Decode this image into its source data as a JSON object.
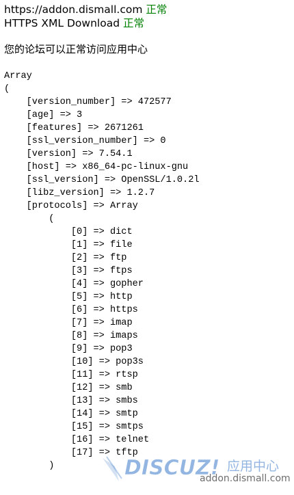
{
  "status": {
    "addon_host": "https://addon.dismall.com",
    "addon_state": "正常",
    "https_xml_label": "HTTPS XML Download",
    "https_xml_state": "正常",
    "message": "您的论坛可以正常访问应用中心"
  },
  "dump_text": "Array\n(\n    [version_number] => 472577\n    [age] => 3\n    [features] => 2671261\n    [ssl_version_number] => 0\n    [version] => 7.54.1\n    [host] => x86_64-pc-linux-gnu\n    [ssl_version] => OpenSSL/1.0.2l\n    [libz_version] => 1.2.7\n    [protocols] => Array\n        (\n            [0] => dict\n            [1] => file\n            [2] => ftp\n            [3] => ftps\n            [4] => gopher\n            [5] => http\n            [6] => https\n            [7] => imap\n            [8] => imaps\n            [9] => pop3\n            [10] => pop3s\n            [11] => rtsp\n            [12] => smb\n            [13] => smbs\n            [14] => smtp\n            [15] => smtps\n            [16] => telnet\n            [17] => tftp\n        )\n",
  "watermark": {
    "brand": "DISCUZ!",
    "brand_cn": "应用中心",
    "domain": "addon.dismall.com",
    "brand_color": "#3a78c8"
  }
}
